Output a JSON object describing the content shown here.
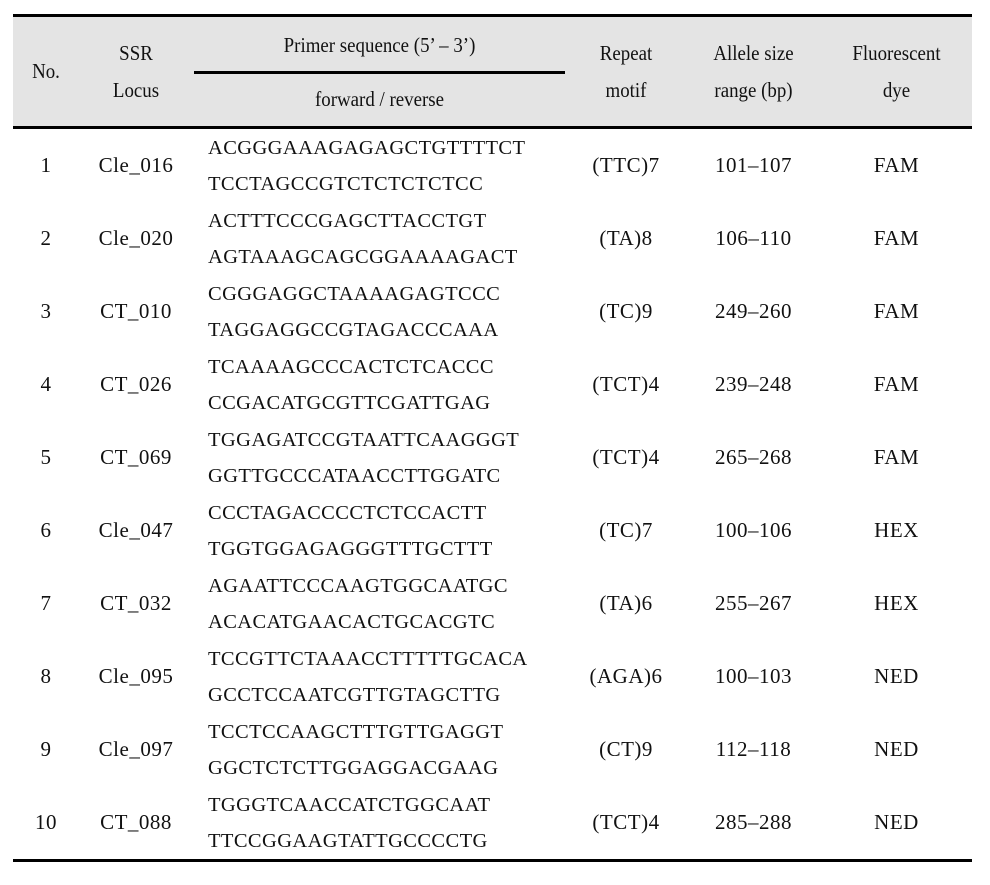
{
  "header": {
    "no": "No.",
    "locus_line1": "SSR",
    "locus_line2": "Locus",
    "primer_top": "Primer sequence (5’ – 3’)",
    "primer_bottom": "forward / reverse",
    "motif_line1": "Repeat",
    "motif_line2": "motif",
    "allele_line1": "Allele size",
    "allele_line2": "range (bp)",
    "dye_line1": "Fluorescent",
    "dye_line2": "dye"
  },
  "rows": [
    {
      "no": "1",
      "locus": "Cle_016",
      "forward": "ACGGGAAAGAGAGCTGTTTTCT",
      "reverse": "TCCTAGCCGTCTCTCTCTCC",
      "motif": "(TTC)7",
      "allele": "101–107",
      "dye": "FAM"
    },
    {
      "no": "2",
      "locus": "Cle_020",
      "forward": "ACTTTCCCGAGCTTACCTGT",
      "reverse": "AGTAAAGCAGCGGAAAAGACT",
      "motif": "(TA)8",
      "allele": "106–110",
      "dye": "FAM"
    },
    {
      "no": "3",
      "locus": "CT_010",
      "forward": "CGGGAGGCTAAAAGAGTCCC",
      "reverse": "TAGGAGGCCGTAGACCCAAA",
      "motif": "(TC)9",
      "allele": "249–260",
      "dye": "FAM"
    },
    {
      "no": "4",
      "locus": "CT_026",
      "forward": "TCAAAAGCCCACTCTCACCC",
      "reverse": "CCGACATGCGTTCGATTGAG",
      "motif": "(TCT)4",
      "allele": "239–248",
      "dye": "FAM"
    },
    {
      "no": "5",
      "locus": "CT_069",
      "forward": "TGGAGATCCGTAATTCAAGGGT",
      "reverse": "GGTTGCCCATAACCTTGGATC",
      "motif": "(TCT)4",
      "allele": "265–268",
      "dye": "FAM"
    },
    {
      "no": "6",
      "locus": "Cle_047",
      "forward": "CCCTAGACCCCTCTCCACTT",
      "reverse": "TGGTGGAGAGGGTTTGCTTT",
      "motif": "(TC)7",
      "allele": "100–106",
      "dye": "HEX"
    },
    {
      "no": "7",
      "locus": "CT_032",
      "forward": "AGAATTCCCAAGTGGCAATGC",
      "reverse": "ACACATGAACACTGCACGTC",
      "motif": "(TA)6",
      "allele": "255–267",
      "dye": "HEX"
    },
    {
      "no": "8",
      "locus": "Cle_095",
      "forward": "TCCGTTCTAAACCTTTTTGCACA",
      "reverse": "GCCTCCAATCGTTGTAGCTTG",
      "motif": "(AGA)6",
      "allele": "100–103",
      "dye": "NED"
    },
    {
      "no": "9",
      "locus": "Cle_097",
      "forward": "TCCTCCAAGCTTTGTTGAGGT",
      "reverse": "GGCTCTCTTGGAGGACGAAG",
      "motif": "(CT)9",
      "allele": "112–118",
      "dye": "NED"
    },
    {
      "no": "10",
      "locus": "CT_088",
      "forward": "TGGGTCAACCATCTGGCAAT",
      "reverse": "TTCCGGAAGTATTGCCCCTG",
      "motif": "(TCT)4",
      "allele": "285–288",
      "dye": "NED"
    }
  ]
}
